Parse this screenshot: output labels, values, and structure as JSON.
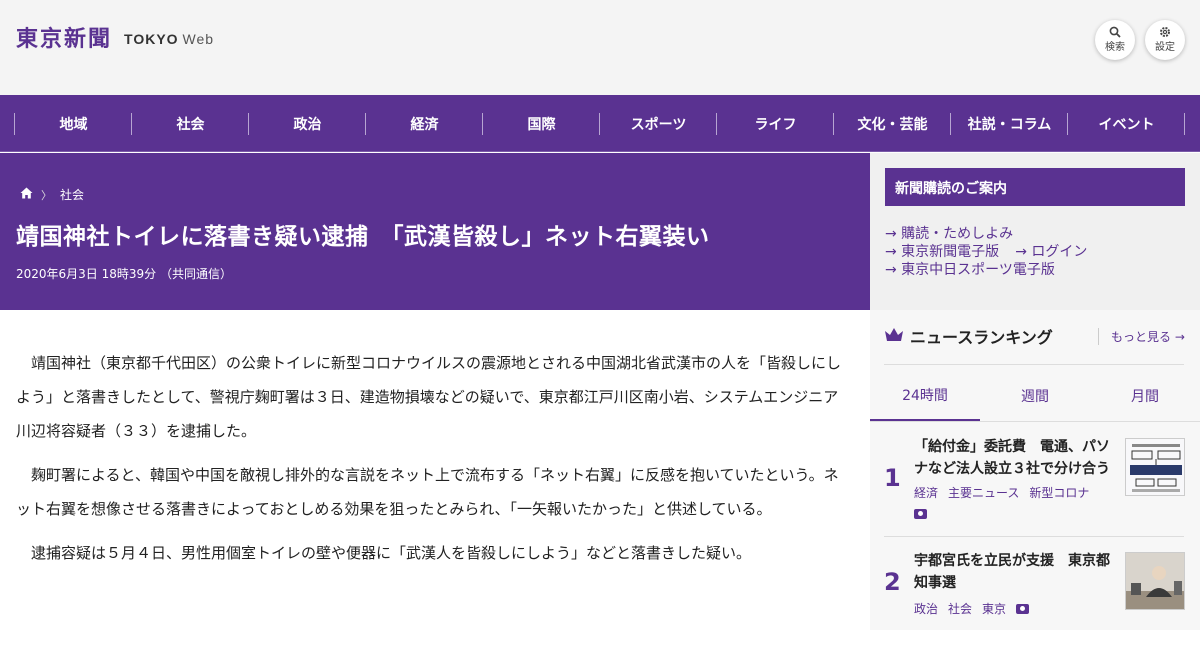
{
  "header": {
    "logo_kanji": "東京新聞",
    "logo_en": "TOKYO",
    "logo_web": "Web",
    "search_label": "検索",
    "settings_label": "設定"
  },
  "nav": [
    "地域",
    "社会",
    "政治",
    "経済",
    "国際",
    "スポーツ",
    "ライフ",
    "文化・芸能",
    "社説・コラム",
    "イベント"
  ],
  "breadcrumb": {
    "home_icon": "home-icon",
    "section": "社会"
  },
  "article": {
    "title": "靖国神社トイレに落書き疑い逮捕　「武漢皆殺し」ネット右翼装い",
    "meta": "2020年6月3日 18時39分 （共同通信）",
    "paragraphs": [
      "　靖国神社（東京都千代田区）の公衆トイレに新型コロナウイルスの震源地とされる中国湖北省武漢市の人を「皆殺しにしよう」と落書きしたとして、警視庁麹町署は３日、建造物損壊などの疑いで、東京都江戸川区南小岩、システムエンジニア川辺将容疑者（３３）を逮捕した。",
      "　麹町署によると、韓国や中国を敵視し排外的な言説をネット上で流布する「ネット右翼」に反感を抱いていたという。ネット右翼を想像させる落書きによっておとしめる効果を狙ったとみられ、「一矢報いたかった」と供述している。",
      "　逮捕容疑は５月４日、男性用個室トイレの壁や便器に「武漢人を皆殺しにしよう」などと落書きした疑い。"
    ]
  },
  "subscription": {
    "heading": "新聞購読のご案内",
    "links": [
      "→ 購読・ためしよみ",
      "→ 東京新聞電子版",
      "→ ログイン",
      "→ 東京中日スポーツ電子版"
    ]
  },
  "ranking": {
    "title": "ニュースランキング",
    "more": "もっと見る →",
    "tabs": [
      "24時間",
      "週間",
      "月間"
    ],
    "active_tab": "24時間",
    "items": [
      {
        "rank": "1",
        "title": "「給付金」委託費　電通、パソナなど法人設立３社で分け合う",
        "tags": [
          "経済",
          "主要ニュース",
          "新型コロナ"
        ],
        "has_photo": true
      },
      {
        "rank": "2",
        "title": "宇都宮氏を立民が支援　東京都知事選",
        "tags": [
          "政治",
          "社会",
          "東京"
        ],
        "has_photo": true
      }
    ]
  },
  "colors": {
    "brand": "#5a3291",
    "header_bg": "#f4f4f4",
    "sidebar_bg": "#f0f0f0"
  }
}
